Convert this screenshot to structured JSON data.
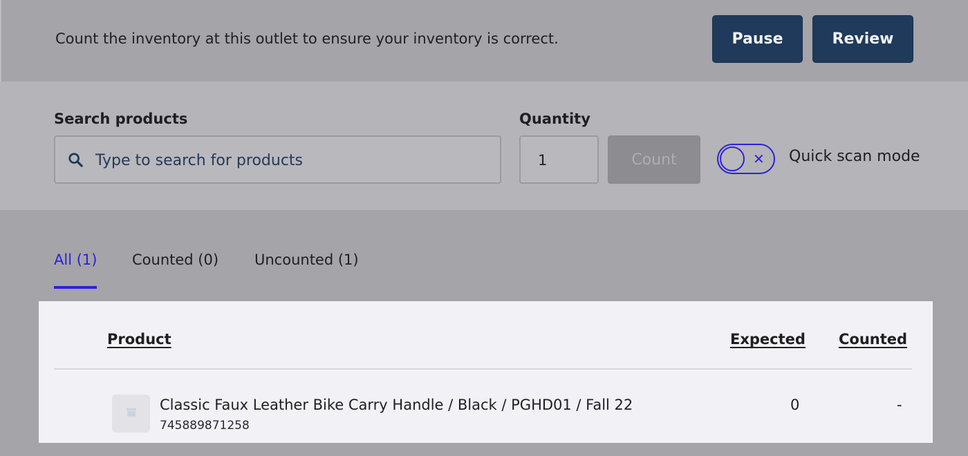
{
  "header": {
    "instruction": "Count the inventory at this outlet to ensure your inventory is correct.",
    "pause_label": "Pause",
    "review_label": "Review"
  },
  "search": {
    "label": "Search products",
    "placeholder": "Type to search for products",
    "quantity_label": "Quantity",
    "quantity_value": "1",
    "count_label": "Count",
    "quick_scan_label": "Quick scan mode",
    "quick_scan_on": false
  },
  "tabs": [
    {
      "label": "All (1)",
      "active": true
    },
    {
      "label": "Counted (0)",
      "active": false
    },
    {
      "label": "Uncounted (1)",
      "active": false
    }
  ],
  "table": {
    "columns": [
      "Product",
      "Expected",
      "Counted"
    ],
    "rows": [
      {
        "name": "Classic Faux Leather Bike Carry Handle / Black / PGHD01 / Fall 22",
        "sku": "745889871258",
        "expected": "0",
        "counted": "-"
      }
    ]
  },
  "colors": {
    "accent": "#2b22d8",
    "primary_button": "#1f3a5b"
  }
}
